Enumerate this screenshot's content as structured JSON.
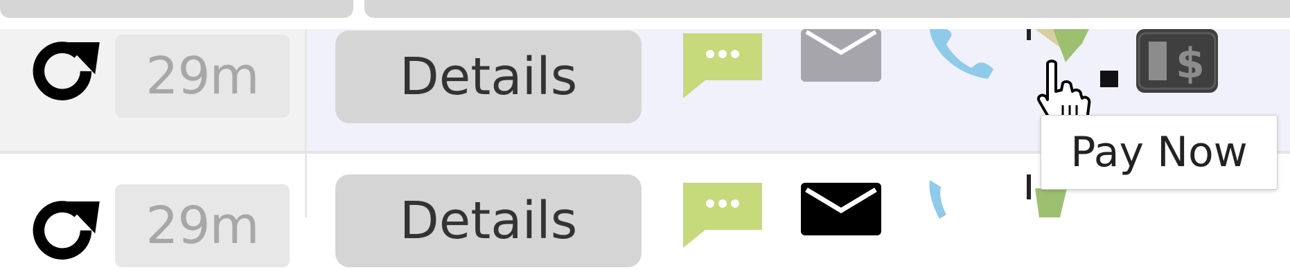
{
  "rows": [
    {
      "refresh_icon": "refresh-icon",
      "elapsed": "29m",
      "details_label": "Details",
      "mail_read": true
    },
    {
      "refresh_icon": "refresh-icon",
      "elapsed": "29m",
      "details_label": "Details",
      "mail_read": false
    }
  ],
  "icons": {
    "chat": "chat-icon",
    "mail": "mail-icon",
    "phone": "phone-icon",
    "payment": "pay-icon",
    "billing": "billing-dollar-icon",
    "cursor": "hand-cursor-icon"
  },
  "tooltip": {
    "text": "Pay Now"
  },
  "colors": {
    "chat_green": "#c6d97b",
    "mail_gray": "#a6a5ab",
    "mail_black": "#000000",
    "phone_blue": "#8fcbe9",
    "row_highlight": "#f1f1fb",
    "button_gray": "#d5d5d5",
    "time_box": "#e7e7e7",
    "time_text": "#a7a7a7"
  }
}
